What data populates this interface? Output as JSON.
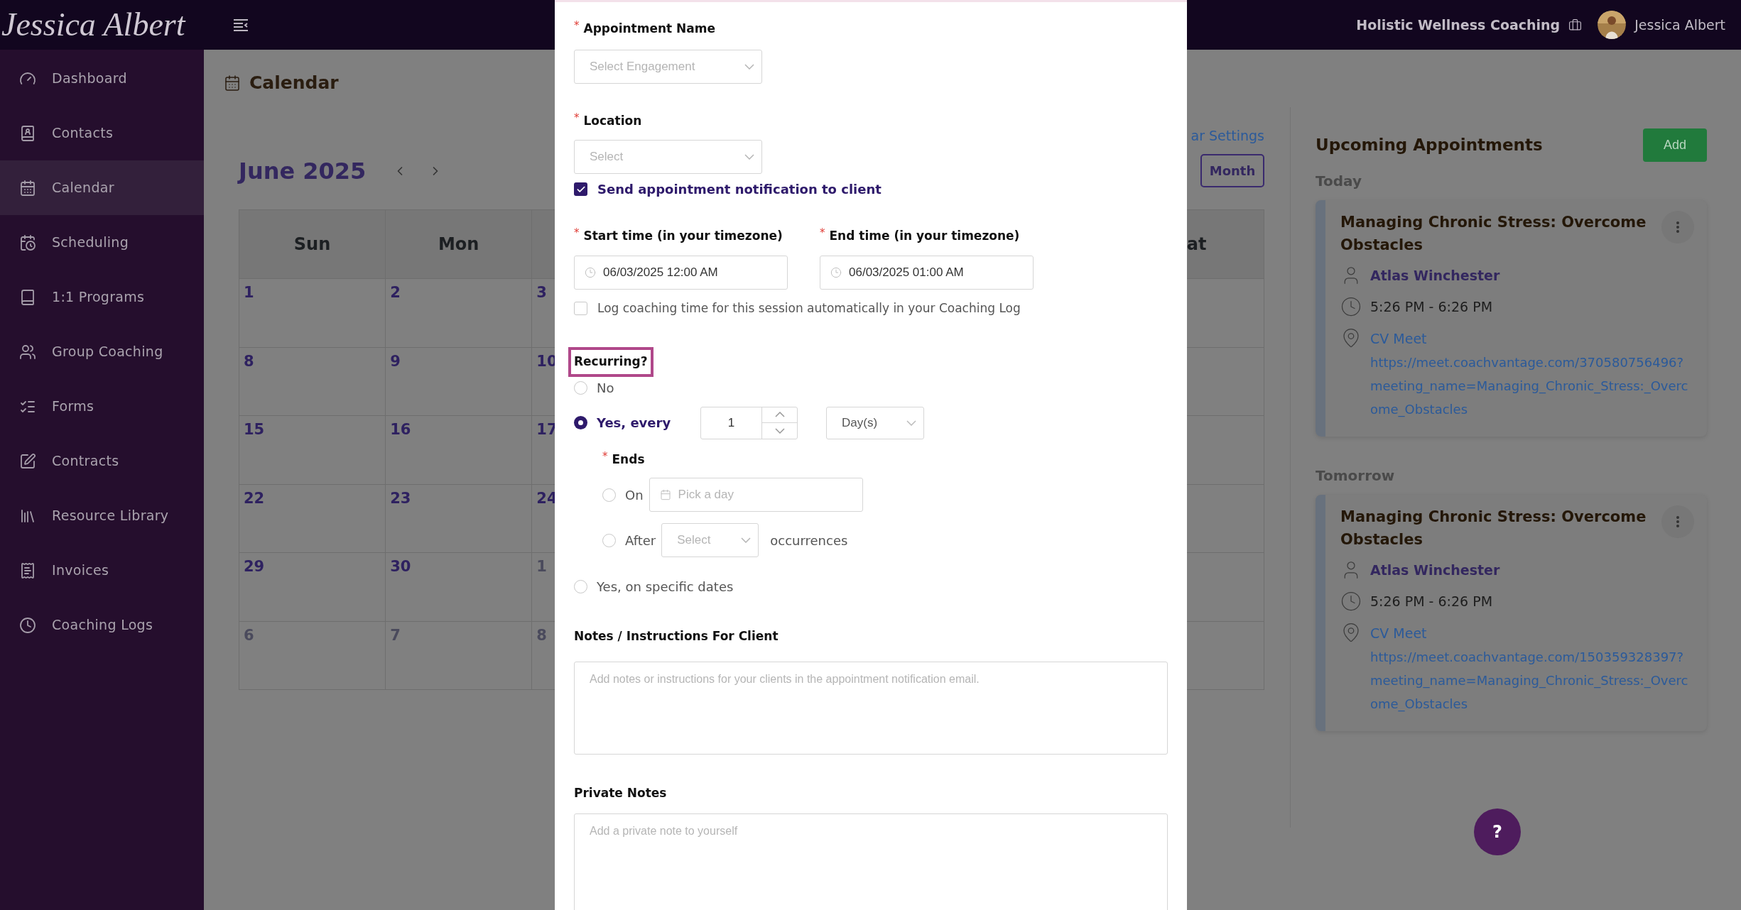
{
  "topbar": {
    "logo": "Jessica Albert",
    "org": "Holistic Wellness Coaching",
    "user": "Jessica Albert"
  },
  "sidebar": {
    "items": [
      {
        "label": "Dashboard",
        "selected": false
      },
      {
        "label": "Contacts",
        "selected": false
      },
      {
        "label": "Calendar",
        "selected": true
      },
      {
        "label": "Scheduling",
        "selected": false
      },
      {
        "label": "1:1 Programs",
        "selected": false
      },
      {
        "label": "Group Coaching",
        "selected": false
      },
      {
        "label": "Forms",
        "selected": false
      },
      {
        "label": "Contracts",
        "selected": false
      },
      {
        "label": "Resource Library",
        "selected": false
      },
      {
        "label": "Invoices",
        "selected": false
      },
      {
        "label": "Coaching Logs",
        "selected": false
      }
    ]
  },
  "calendar": {
    "title": "Calendar",
    "settings_link": "ar Settings",
    "view_button": "Month",
    "month": "June 2025",
    "headers": [
      {
        "label": "Sun"
      },
      {
        "label": "Mon"
      }
    ],
    "column_7_header": "at",
    "weeks": [
      {
        "days": [
          {
            "label": "1",
            "muted": false
          },
          {
            "label": "2",
            "muted": false
          },
          {
            "label": "3",
            "muted": false
          }
        ]
      },
      {
        "days": [
          {
            "label": "8",
            "muted": false
          },
          {
            "label": "9",
            "muted": false
          },
          {
            "label": "10",
            "muted": false
          }
        ]
      },
      {
        "days": [
          {
            "label": "15",
            "muted": false
          },
          {
            "label": "16",
            "muted": false
          },
          {
            "label": "17",
            "muted": false
          }
        ]
      },
      {
        "days": [
          {
            "label": "22",
            "muted": false
          },
          {
            "label": "23",
            "muted": false
          },
          {
            "label": "24",
            "muted": false
          }
        ]
      },
      {
        "days": [
          {
            "label": "29",
            "muted": false
          },
          {
            "label": "30",
            "muted": false
          },
          {
            "label": "1",
            "muted": true
          }
        ]
      },
      {
        "days": [
          {
            "label": "6",
            "muted": true
          },
          {
            "label": "7",
            "muted": true
          },
          {
            "label": "8",
            "muted": true
          }
        ]
      }
    ]
  },
  "upcoming": {
    "title": "Upcoming Appointments",
    "add_button": "Add",
    "groups": [
      {
        "label": "Today",
        "appointments": [
          {
            "title": "Managing Chronic Stress: Overcome Obstacles",
            "client": "Atlas Winchester",
            "time": "5:26 PM - 6:26 PM",
            "location": "CV Meet",
            "link": "https://meet.coachvantage.com/370580756496?meeting_name=Managing_Chronic_Stress:_Overcome_Obstacles"
          }
        ]
      },
      {
        "label": "Tomorrow",
        "appointments": [
          {
            "title": "Managing Chronic Stress: Overcome Obstacles",
            "client": "Atlas Winchester",
            "time": "5:26 PM - 6:26 PM",
            "location": "CV Meet",
            "link": "https://meet.coachvantage.com/150359328397?meeting_name=Managing_Chronic_Stress:_Overcome_Obstacles"
          }
        ]
      }
    ]
  },
  "help_button": "?",
  "modal": {
    "appointment_name": {
      "required_mark": "*",
      "label": "Appointment Name",
      "placeholder": "Select Engagement"
    },
    "location": {
      "required_mark": "*",
      "label": "Location",
      "placeholder": "Select"
    },
    "notify": {
      "label": "Send appointment notification to client",
      "checked": true
    },
    "start_time": {
      "required_mark": "*",
      "label": "Start time (in your timezone)",
      "value": "06/03/2025 12:00 AM"
    },
    "end_time": {
      "required_mark": "*",
      "label": "End time (in your timezone)",
      "value": "06/03/2025 01:00 AM"
    },
    "log_time": {
      "label": "Log coaching time for this session automatically in your Coaching Log",
      "checked": false
    },
    "recurring": {
      "label": "Recurring?",
      "highlighted": true,
      "options": [
        {
          "label": "No",
          "selected": false,
          "kind": "plain"
        },
        {
          "label": "Yes, every",
          "selected": true,
          "kind": "interval"
        },
        {
          "label": "Yes, on specific dates",
          "selected": false,
          "kind": "plain"
        }
      ],
      "interval": {
        "value": "1"
      },
      "unit": {
        "value": "Day(s)"
      },
      "ends": {
        "required_mark": "*",
        "label": "Ends",
        "options": [
          {
            "label": "On",
            "selected": false,
            "kind": "date",
            "placeholder": "Pick a day"
          },
          {
            "label": "After",
            "selected": false,
            "kind": "count",
            "placeholder": "Select",
            "suffix": "occurrences"
          }
        ]
      }
    },
    "notes": {
      "label": "Notes / Instructions For Client",
      "placeholder": "Add notes or instructions for your clients in the appointment notification email."
    },
    "private_notes": {
      "label": "Private Notes",
      "placeholder": "Add a private note to yourself"
    }
  }
}
